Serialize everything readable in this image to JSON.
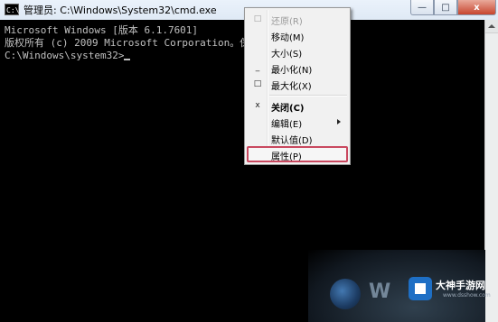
{
  "window": {
    "title": "管理员: C:\\Windows\\System32\\cmd.exe",
    "app_icon_text": "C:\\",
    "minimize_glyph": "—",
    "maximize_glyph": "□",
    "close_glyph": "x"
  },
  "console": {
    "lines": [
      "Microsoft Windows [版本 6.1.7601]",
      "版权所有 (c) 2009 Microsoft Corporation。保留所有权利。",
      "",
      "C:\\Windows\\system32>"
    ]
  },
  "context_menu": {
    "items": [
      {
        "label": "还原(R)",
        "icon": "restore-icon",
        "glyph": "□",
        "enabled": false
      },
      {
        "label": "移动(M)",
        "icon": "",
        "glyph": "",
        "enabled": true
      },
      {
        "label": "大小(S)",
        "icon": "",
        "glyph": "",
        "enabled": true
      },
      {
        "label": "最小化(N)",
        "icon": "minimize-icon",
        "glyph": "_",
        "enabled": true
      },
      {
        "label": "最大化(X)",
        "icon": "maximize-icon",
        "glyph": "□",
        "enabled": true
      },
      {
        "label": "关闭(C)",
        "icon": "close-icon",
        "glyph": "x",
        "enabled": true,
        "bold": true
      },
      {
        "label": "编辑(E)",
        "icon": "",
        "glyph": "",
        "enabled": true,
        "submenu": true
      },
      {
        "label": "默认值(D)",
        "icon": "",
        "glyph": "",
        "enabled": true
      },
      {
        "label": "属性(P)",
        "icon": "",
        "glyph": "",
        "enabled": true,
        "selected": true
      }
    ]
  },
  "watermark": {
    "w_text": "W",
    "brand_name": "大神手游网",
    "brand_url": "www.dsshow.com"
  },
  "colors": {
    "console_bg": "#000000",
    "console_text": "#c0c0c0",
    "selected_border": "#c9485f"
  }
}
